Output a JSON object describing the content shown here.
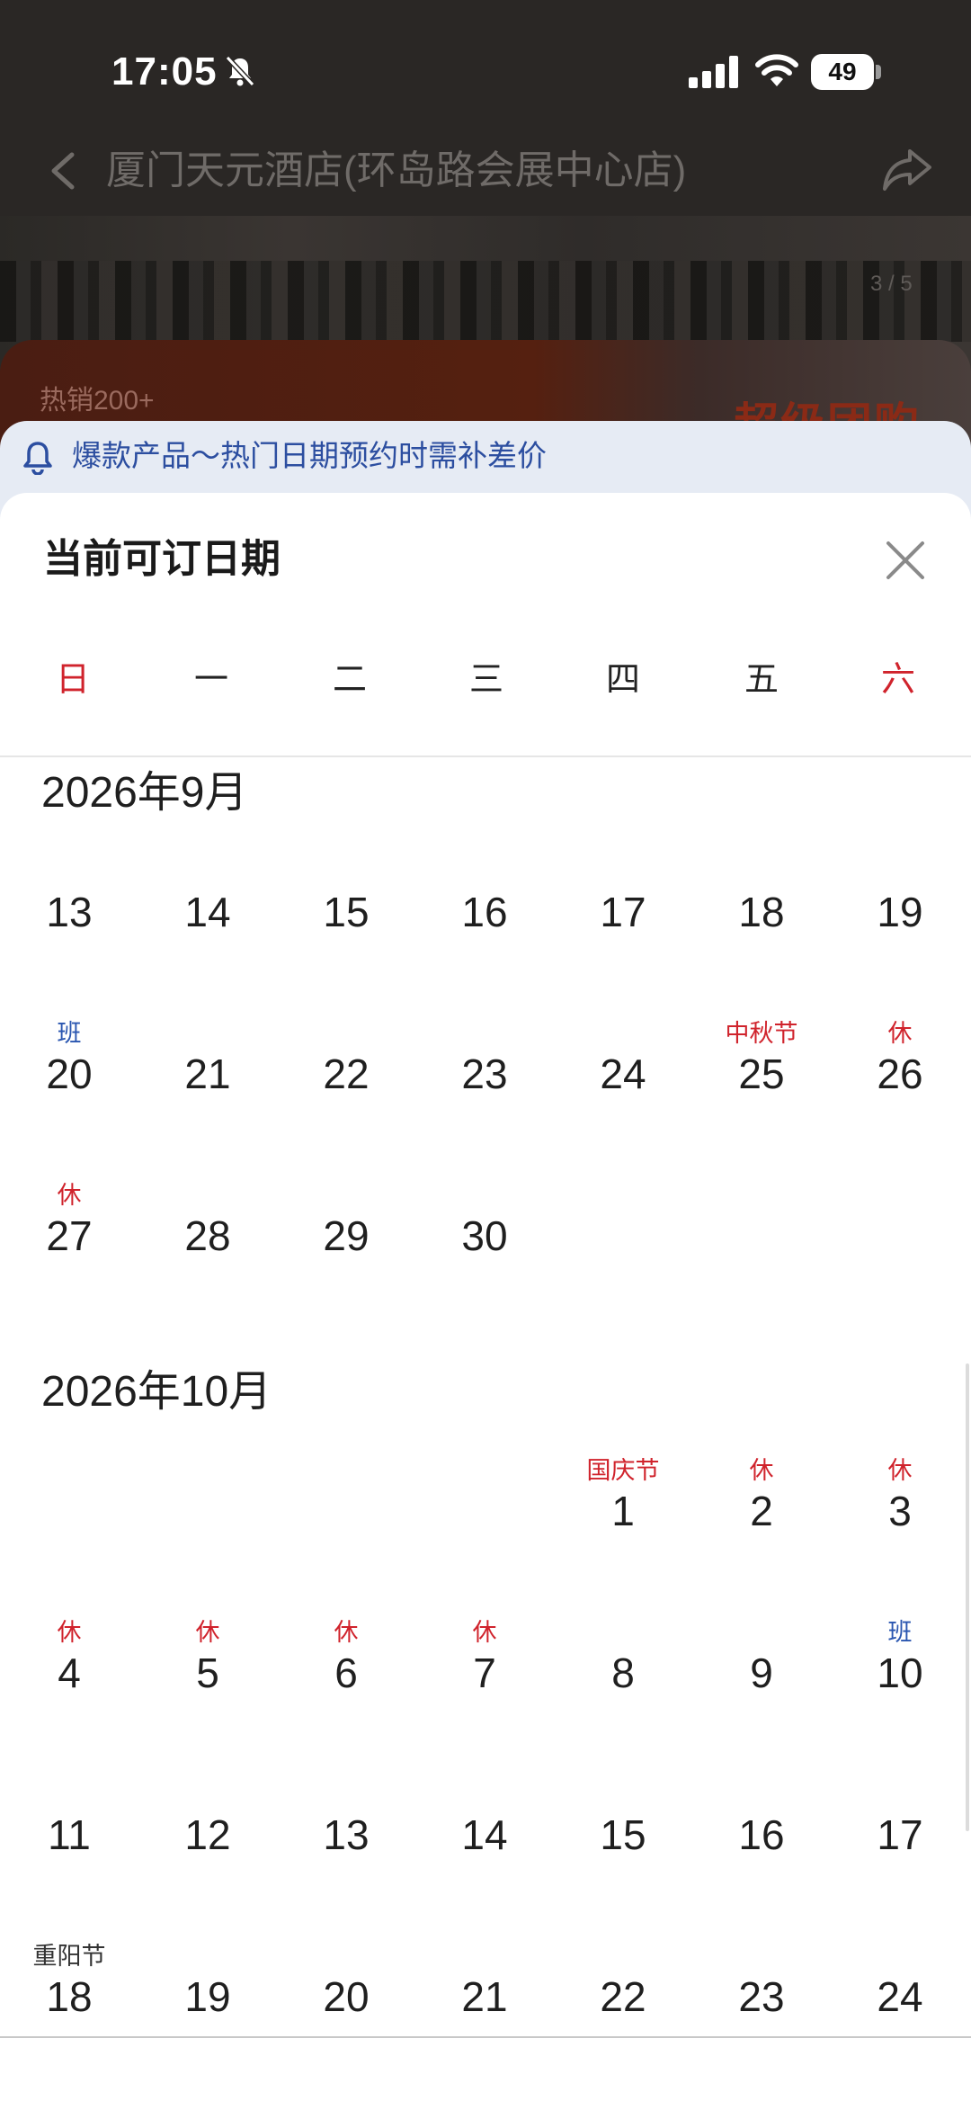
{
  "status_bar": {
    "time": "17:05",
    "battery": "49"
  },
  "background": {
    "hotel_title": "厦门天元酒店(环岛路会展中心店)",
    "image_indicator": "3 / 5",
    "hot_sales": "热销200+",
    "promo_text": "超级团购"
  },
  "notice": {
    "text": "爆款产品～热门日期预约时需补差价"
  },
  "sheet": {
    "title": "当前可订日期",
    "weekdays": [
      "日",
      "一",
      "二",
      "三",
      "四",
      "五",
      "六"
    ],
    "months": [
      {
        "title": "2026年9月",
        "rows": [
          [
            {
              "d": "13"
            },
            {
              "d": "14"
            },
            {
              "d": "15"
            },
            {
              "d": "16"
            },
            {
              "d": "17"
            },
            {
              "d": "18"
            },
            {
              "d": "19"
            }
          ],
          [
            {
              "d": "20",
              "tag": "班",
              "tag_color": "blue"
            },
            {
              "d": "21"
            },
            {
              "d": "22"
            },
            {
              "d": "23"
            },
            {
              "d": "24"
            },
            {
              "d": "25",
              "tag": "中秋节",
              "tag_color": "red"
            },
            {
              "d": "26",
              "tag": "休",
              "tag_color": "red"
            }
          ],
          [
            {
              "d": "27",
              "tag": "休",
              "tag_color": "red"
            },
            {
              "d": "28"
            },
            {
              "d": "29"
            },
            {
              "d": "30"
            },
            null,
            null,
            null
          ]
        ]
      },
      {
        "title": "2026年10月",
        "rows": [
          [
            null,
            null,
            null,
            null,
            {
              "d": "1",
              "tag": "国庆节",
              "tag_color": "red"
            },
            {
              "d": "2",
              "tag": "休",
              "tag_color": "red"
            },
            {
              "d": "3",
              "tag": "休",
              "tag_color": "red"
            }
          ],
          [
            {
              "d": "4",
              "tag": "休",
              "tag_color": "red"
            },
            {
              "d": "5",
              "tag": "休",
              "tag_color": "red"
            },
            {
              "d": "6",
              "tag": "休",
              "tag_color": "red"
            },
            {
              "d": "7",
              "tag": "休",
              "tag_color": "red"
            },
            {
              "d": "8"
            },
            {
              "d": "9"
            },
            {
              "d": "10",
              "tag": "班",
              "tag_color": "blue"
            }
          ],
          [
            {
              "d": "11"
            },
            {
              "d": "12"
            },
            {
              "d": "13"
            },
            {
              "d": "14"
            },
            {
              "d": "15"
            },
            {
              "d": "16"
            },
            {
              "d": "17"
            }
          ],
          [
            {
              "d": "18",
              "tag": "重阳节",
              "tag_color": "dark"
            },
            {
              "d": "19"
            },
            {
              "d": "20"
            },
            {
              "d": "21"
            },
            {
              "d": "22"
            },
            {
              "d": "23"
            },
            {
              "d": "24"
            }
          ]
        ]
      }
    ]
  },
  "colors": {
    "holiday_red": "#d0232c",
    "workday_blue": "#2a56b0",
    "notice_bg": "#e6ebf4",
    "notice_text": "#2c4ea0"
  },
  "icons": [
    "bell-slash-icon",
    "signal-icon",
    "wifi-icon",
    "battery-icon",
    "back-arrow-icon",
    "share-icon",
    "bell-icon",
    "close-icon"
  ]
}
